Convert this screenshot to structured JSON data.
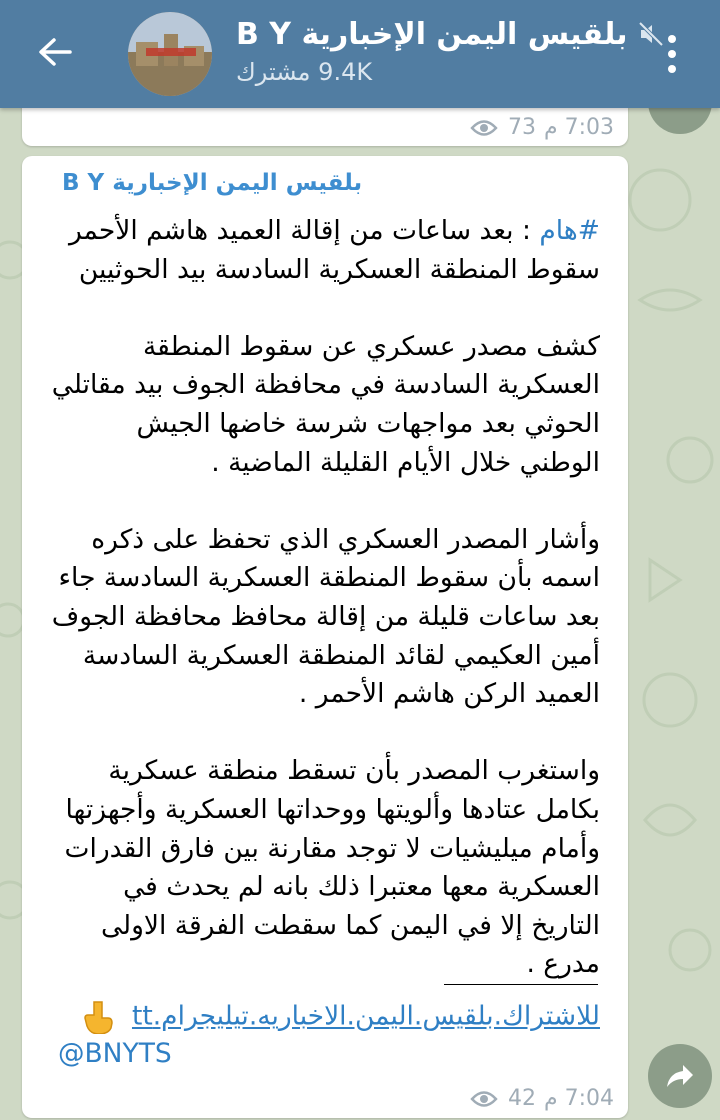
{
  "header": {
    "channel_title": "بلقيس اليمن الإخبارية B Y",
    "subscribers": "9.4K مشترك",
    "back_icon": "arrow-left-icon",
    "mute_icon": "muted-speaker-icon",
    "menu_icon": "vertical-dots-icon",
    "avatar_alt": "channel-logo"
  },
  "prev_message": {
    "time": "7:03 م",
    "views": "73"
  },
  "message": {
    "author": "بلقيس اليمن الإخبارية B Y",
    "hashtag": "#هام",
    "headline_rest": " : بعد ساعات من إقالة العميد هاشم الأحمر سقوط المنطقة العسكرية السادسة بيد الحوثيين",
    "paragraph_1": "كشف مصدر عسكري عن سقوط المنطقة العسكرية السادسة في محافظة الجوف بيد مقاتلي الحوثي بعد مواجهات شرسة خاضها الجيش الوطني خلال الأيام القليلة الماضية .",
    "paragraph_2": "وأشار المصدر العسكري الذي تحفظ على ذكره اسمه بأن سقوط المنطقة العسكرية السادسة جاء بعد ساعات قليلة من إقالة محافظ محافظة الجوف أمين العكيمي لقائد المنطقة العسكرية السادسة العميد الركن هاشم الأحمر .",
    "paragraph_3": "واستغرب المصدر بأن تسقط منطقة عسكرية بكامل عتادها وألويتها ووحداتها العسكرية وأجهزتها وأمام ميليشيات لا توجد مقارنة بين فارق القدرات العسكرية معها معتبرا ذلك بانه لم يحدث في التاريخ إلا في اليمن كما سقطت الفرقة الاولى مدرع .",
    "subscribe_link": "للاشتراك.بلقيس.اليمن.الاخباريه.تيليجرام.tt",
    "pointing_icon": "pointing-down-hand-icon",
    "handle": "@BNYTS",
    "time": "7:04 م",
    "views": "42"
  },
  "colors": {
    "header_bg": "#517da2",
    "link": "#2f7fc4",
    "author": "#3e8ed0",
    "wallpaper": "#cfd9c5"
  }
}
